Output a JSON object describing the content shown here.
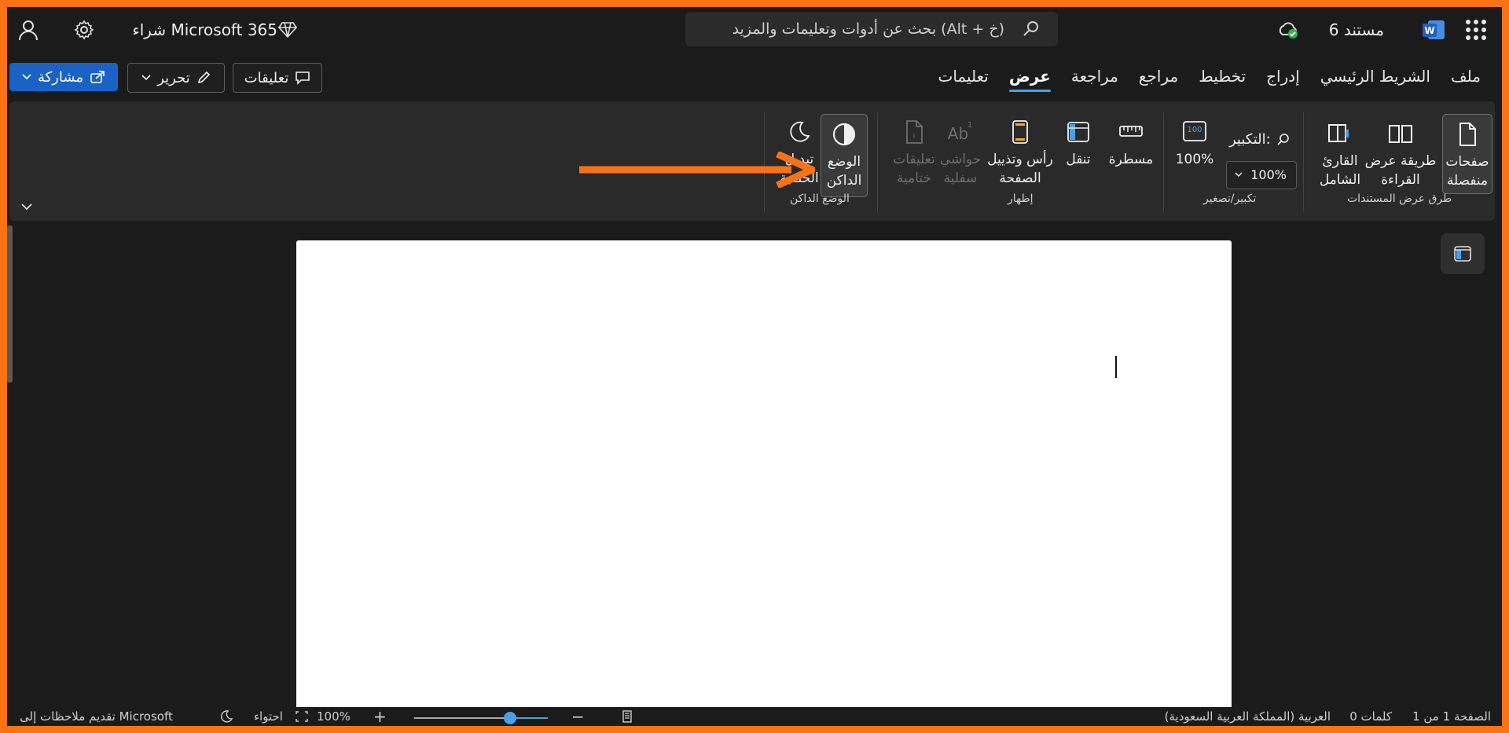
{
  "window": {
    "doc_title": "مستند 6",
    "buy_label": "شراء Microsoft 365",
    "search_placeholder": "بحث عن أدوات وتعليمات والمزيد (Alt + خ)"
  },
  "tabs": [
    {
      "label": "ملف",
      "active": false
    },
    {
      "label": "الشريط الرئيسي",
      "active": false
    },
    {
      "label": "إدراج",
      "active": false
    },
    {
      "label": "تخطيط",
      "active": false
    },
    {
      "label": "مراجع",
      "active": false
    },
    {
      "label": "مراجعة",
      "active": false
    },
    {
      "label": "عرض",
      "active": true
    },
    {
      "label": "تعليمات",
      "active": false
    }
  ],
  "actions": {
    "share": "مشاركة",
    "edit": "تحرير",
    "comments": "تعليقات"
  },
  "ribbon": {
    "separate_pages": [
      "صفحات",
      "منفصلة"
    ],
    "reading_view": [
      "طريقة عرض",
      "القراءة"
    ],
    "immersive_reader": [
      "القارئ",
      "الشامل"
    ],
    "group_views": "طرق عرض المستندات",
    "zoom_label": "التكبير:",
    "zoom_value": "100%",
    "zoom_100": "100%",
    "group_zoom": "تكبير/تصغير",
    "ruler": "مسطرة",
    "navigation": "تنقل",
    "header_footer": [
      "رأس وتذييل",
      "الصفحة"
    ],
    "footnotes": [
      "حواشي",
      "سفلية"
    ],
    "endnotes": [
      "تعليقات",
      "ختامية"
    ],
    "group_show": "إظهار",
    "dark_mode": [
      "الوضع",
      "الداكن"
    ],
    "switch_background": [
      "تبديل",
      "الخلفية"
    ],
    "group_dark_mode": "الوضع الداكن"
  },
  "status": {
    "page": "الصفحة 1 من 1",
    "words": "0 كلمات",
    "language": "العربية (المملكة العربية السعودية)",
    "zoom": "100%",
    "fit": "احتواء",
    "feedback": "تقديم ملاحظات إلى Microsoft",
    "zoom_level": 0.72
  },
  "colors": {
    "accent": "#4aa0e8",
    "share_button": "#1a62c6",
    "annotation_arrow": "#f97316",
    "frame": "#f97316"
  }
}
